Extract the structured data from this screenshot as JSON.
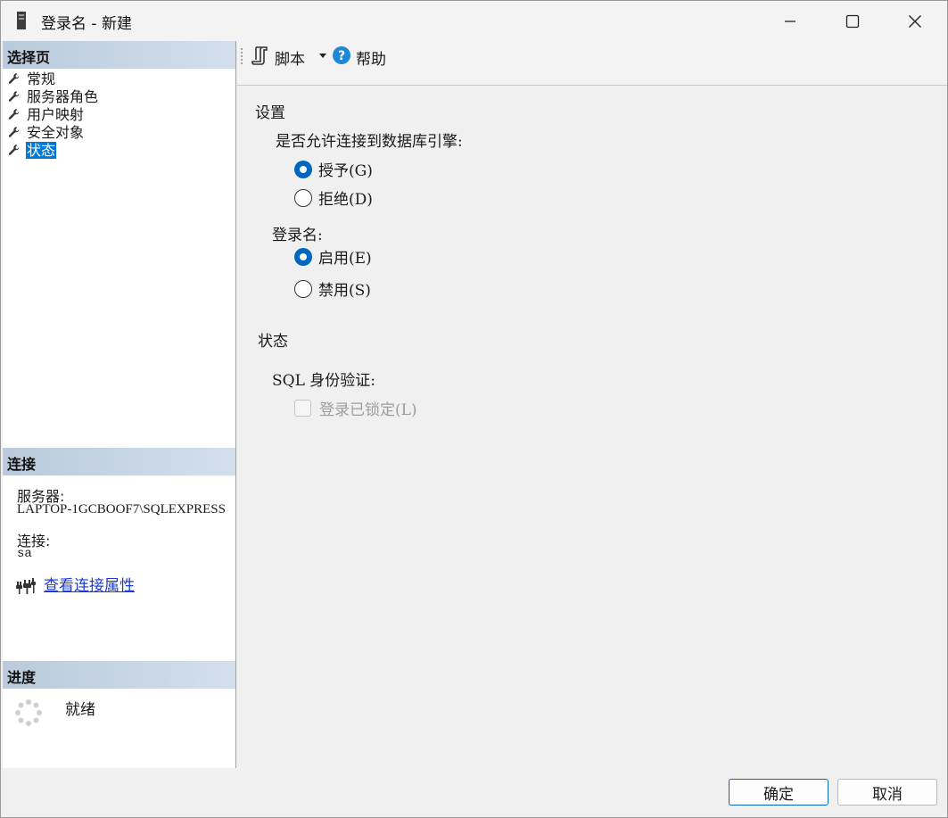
{
  "window": {
    "title": "登录名 - 新建"
  },
  "left": {
    "pages_header": "选择页",
    "pages": [
      {
        "label": "常规",
        "selected": false
      },
      {
        "label": "服务器角色",
        "selected": false
      },
      {
        "label": "用户映射",
        "selected": false
      },
      {
        "label": "安全对象",
        "selected": false
      },
      {
        "label": "状态",
        "selected": true
      }
    ],
    "connection_header": "连接",
    "server_label": "服务器:",
    "server_value": "LAPTOP-1GCBOOF7\\SQLEXPRESS",
    "connection_label": "连接:",
    "connection_value": "sa",
    "view_props_link": "查看连接属性",
    "progress_header": "进度",
    "progress_status": "就绪"
  },
  "toolbar": {
    "script_label": "脚本",
    "help_label": "帮助"
  },
  "settings": {
    "title": "设置",
    "permission_question": "是否允许连接到数据库引擎:",
    "grant_label": "授予(G)",
    "deny_label": "拒绝(D)",
    "permission_value": "grant",
    "login_label": "登录名:",
    "enable_label": "启用(E)",
    "disable_label": "禁用(S)",
    "login_value": "enable"
  },
  "status": {
    "title": "状态",
    "sql_auth_label": "SQL 身份验证:",
    "locked_label": "登录已锁定(L)",
    "locked_checked": false,
    "locked_disabled": true
  },
  "buttons": {
    "ok": "确定",
    "cancel": "取消"
  },
  "colors": {
    "accent": "#0067c0",
    "selection": "#0078d7",
    "link": "#1a3ad6",
    "header_gradient_start": "#b9cadc",
    "header_gradient_end": "#d3dfec"
  }
}
